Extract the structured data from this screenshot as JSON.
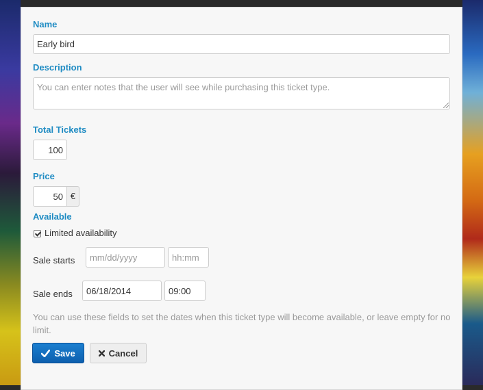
{
  "form": {
    "name_label": "Name",
    "name_value": "Early bird",
    "description_label": "Description",
    "description_placeholder": "You can enter notes that the user will see while purchasing this ticket type.",
    "total_tickets_label": "Total Tickets",
    "total_tickets_value": "100",
    "price_label": "Price",
    "price_value": "50",
    "currency_symbol": "€",
    "available_label": "Available",
    "limited_availability_label": "Limited availability",
    "limited_availability_checked": true,
    "sale_starts_label": "Sale starts",
    "sale_starts_date_placeholder": "mm/dd/yyyy",
    "sale_starts_time_placeholder": "hh:mm",
    "sale_ends_label": "Sale ends",
    "sale_ends_date_value": "06/18/2014",
    "sale_ends_time_value": "09:00",
    "help_text": "You can use these fields to set the dates when this ticket type will become available, or leave empty for no limit."
  },
  "buttons": {
    "save_label": "Save",
    "save_icon": "check-icon",
    "cancel_label": "Cancel",
    "cancel_icon": "x-icon"
  },
  "colors": {
    "label_blue": "#1e8bc3",
    "primary_button": "#0d5fae",
    "help_text": "#999999"
  }
}
